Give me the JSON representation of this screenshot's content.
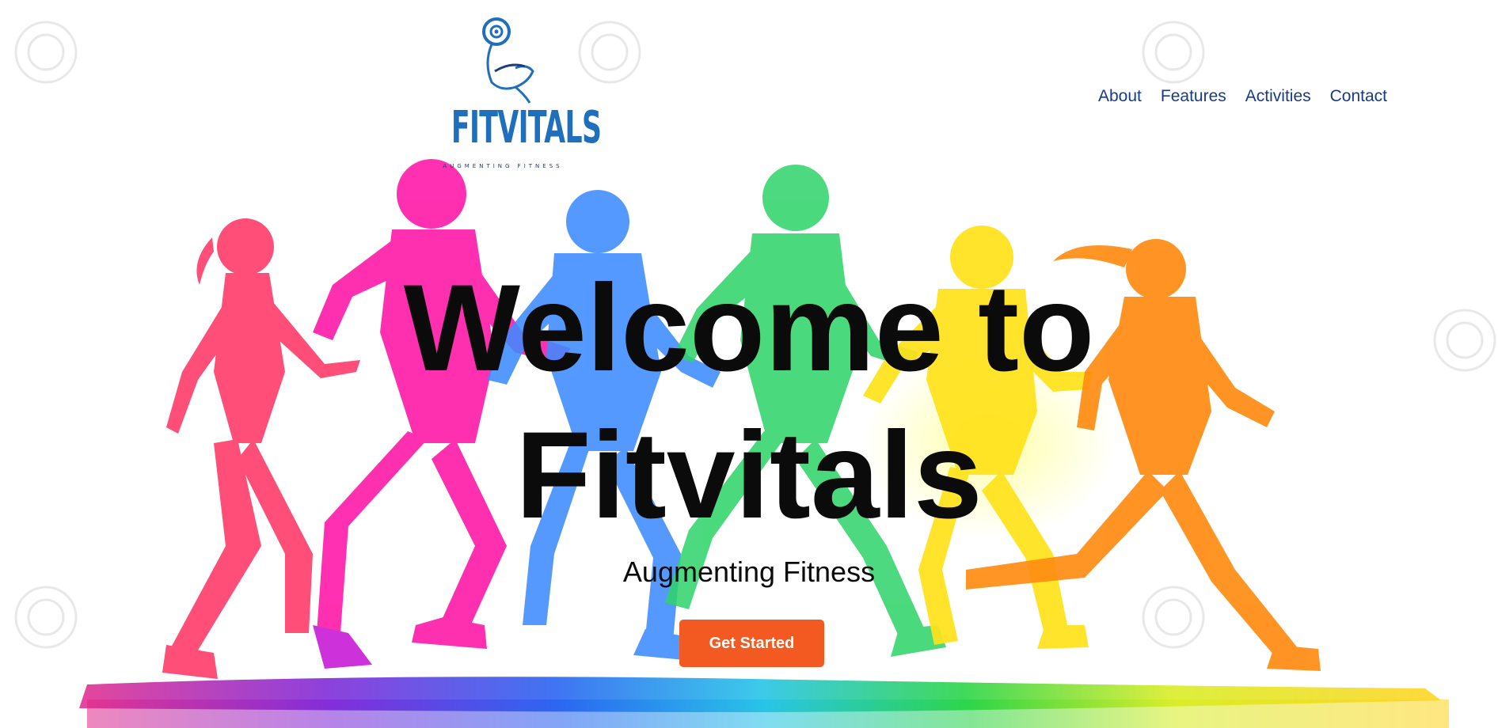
{
  "brand": {
    "name": "FITVITALS",
    "tagline": "Augmenting Fitness",
    "color": "#1f6fbd"
  },
  "nav": {
    "items": [
      {
        "label": "About"
      },
      {
        "label": "Features"
      },
      {
        "label": "Activities"
      },
      {
        "label": "Contact"
      }
    ],
    "color": "#173b86"
  },
  "hero": {
    "title_line1": "Welcome to",
    "title_line2": "Fitvitals",
    "subtitle": "Augmenting Fitness",
    "cta_label": "Get Started",
    "cta_color": "#f35a22",
    "illustration": "rainbow-runners-silhouettes",
    "runner_colors": [
      "#ff3f6c",
      "#ff1aa8",
      "#3d8bff",
      "#2ed36a",
      "#ffe21a",
      "#ff8c12"
    ]
  }
}
